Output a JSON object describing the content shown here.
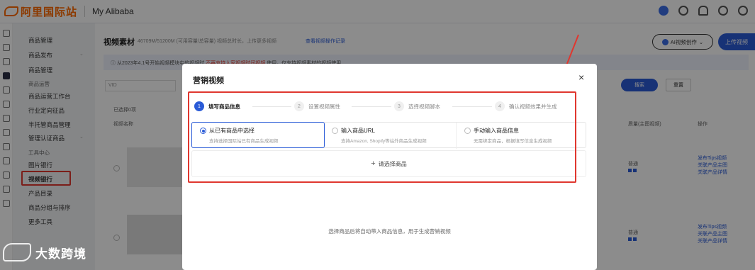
{
  "topbar": {
    "logo_text": "阿里国际站",
    "app_name": "My Alibaba"
  },
  "sidemenu": {
    "items": [
      {
        "label": "商品管理",
        "type": "group"
      },
      {
        "label": "商品发布",
        "type": "item"
      },
      {
        "label": "商品管理",
        "type": "item"
      },
      {
        "label": "商品运营",
        "type": "group"
      },
      {
        "label": "商品运营工作台",
        "type": "item"
      },
      {
        "label": "行业定向征品",
        "type": "item"
      },
      {
        "label": "半托管商品管理",
        "type": "item"
      },
      {
        "label": "管理认证商品",
        "type": "item"
      },
      {
        "label": "工具中心",
        "type": "group"
      },
      {
        "label": "图片银行",
        "type": "item"
      },
      {
        "label": "视频银行",
        "type": "item",
        "active": true
      },
      {
        "label": "产品目录",
        "type": "item"
      },
      {
        "label": "商品分组与排序",
        "type": "item"
      },
      {
        "label": "更多工具",
        "type": "item"
      }
    ]
  },
  "main": {
    "title": "视频素材",
    "title_meta": "46709M/51200M (可用容量/总容量) 视频总时长，上传更多视频",
    "title_link": "查看视频操作记录",
    "ai_button": "AI视频创作",
    "upload_button": "上传视频",
    "notice_prefix": "从2023年4.1号开始视频模块中的视频时",
    "notice_red": "不再支持人家视频时间视频",
    "notice_suffix": "使用，仅支持视频素材的视频使用",
    "filter_placeholder": "VID",
    "search_button": "搜索",
    "reset_button": "重置",
    "selected_label": "已选择0项",
    "col_name": "视频名称",
    "col_quality": "质量(主图视频)",
    "col_action": "操作",
    "rows": [
      {
        "quality": "普通",
        "links": [
          "发布Tips视频",
          "关联产品主图",
          "关联产品详情"
        ]
      },
      {
        "quality": "普通",
        "links": [
          "发布Tips视频",
          "关联产品主图",
          "关联产品详情"
        ]
      }
    ]
  },
  "dialog": {
    "title": "营销视频",
    "close": "×",
    "steps": [
      {
        "num": "1",
        "label": "填写商品信息",
        "active": true
      },
      {
        "num": "2",
        "label": "设置视频属性",
        "active": false
      },
      {
        "num": "3",
        "label": "选择视频脚本",
        "active": false
      },
      {
        "num": "4",
        "label": "确认视频效果并生成",
        "active": false
      }
    ],
    "options": [
      {
        "title": "从已有商品中选择",
        "sub": "支持选择国际站已有商品生成视频",
        "selected": true
      },
      {
        "title": "输入商品URL",
        "sub": "支持Amazon, Shopify等站外商品生成视频",
        "selected": false
      },
      {
        "title": "手动输入商品信息",
        "sub": "无需绑定商品，根据填写信息生成视频",
        "selected": false
      }
    ],
    "choose_label": "请选择商品",
    "hint": "选择商品后将自动带入商品信息，用于生成营销视频"
  },
  "watermark": {
    "text": "大数跨境"
  }
}
